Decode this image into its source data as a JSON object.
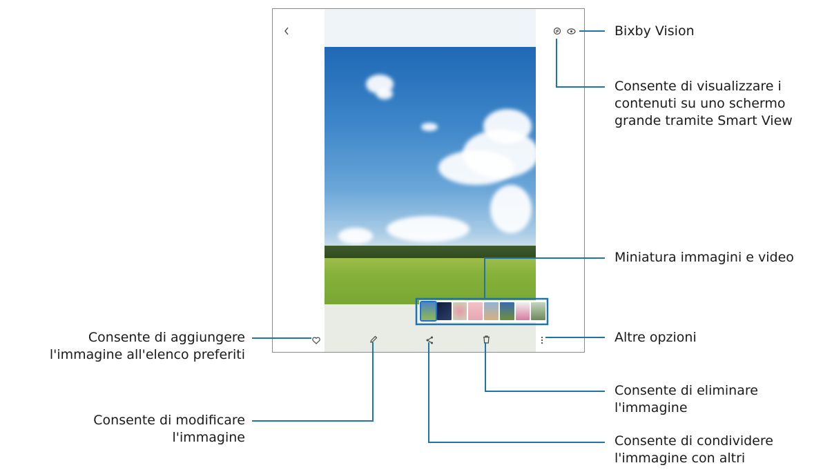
{
  "callouts": {
    "bixby_vision": "Bixby Vision",
    "smart_view": [
      "Consente di visualizzare i",
      "contenuti su uno schermo",
      "grande tramite Smart View"
    ],
    "thumbnails": "Miniatura immagini e video",
    "more_options": "Altre opzioni",
    "delete": [
      "Consente di eliminare",
      "l'immagine"
    ],
    "share": [
      "Consente di condividere",
      "l'immagine con altri"
    ],
    "favorite": [
      "Consente di aggiungere",
      "l'immagine all'elenco preferiti"
    ],
    "edit": [
      "Consente di modificare",
      "l'immagine"
    ]
  },
  "icons": {
    "back": "chevron-left-icon",
    "smart_view": "smart-view-icon",
    "bixby_vision": "eye-icon",
    "favorite": "heart-icon",
    "edit": "pencil-icon",
    "share": "share-icon",
    "delete": "trash-icon",
    "more": "more-vertical-icon"
  },
  "colors": {
    "callout_line": "#1f73a8",
    "frame": "#8a8a8a"
  }
}
